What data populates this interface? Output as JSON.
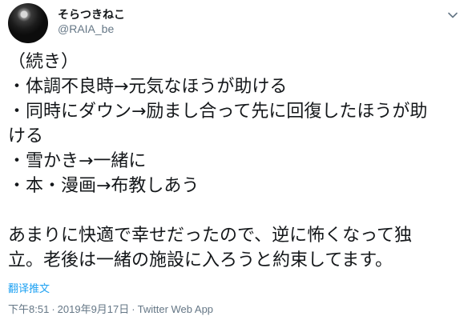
{
  "user": {
    "display_name": "そらつきねこ",
    "handle": "@RAIA_be"
  },
  "tweet": {
    "text": "（続き）\n・体調不良時→元気なほうが助ける\n・同時にダウン→励まし合って先に回復したほうが助\nける\n・雪かき→一緒に\n・本・漫画→布教しあう\n\nあまりに快適で幸せだったので、逆に怖くなって独\n立。老後は一緒の施設に入ろうと約束してます。",
    "translate_label": "翻译推文"
  },
  "meta": {
    "time": "下午8:51",
    "separator": "·",
    "date": "2019年9月17日",
    "source": "Twitter Web App"
  }
}
